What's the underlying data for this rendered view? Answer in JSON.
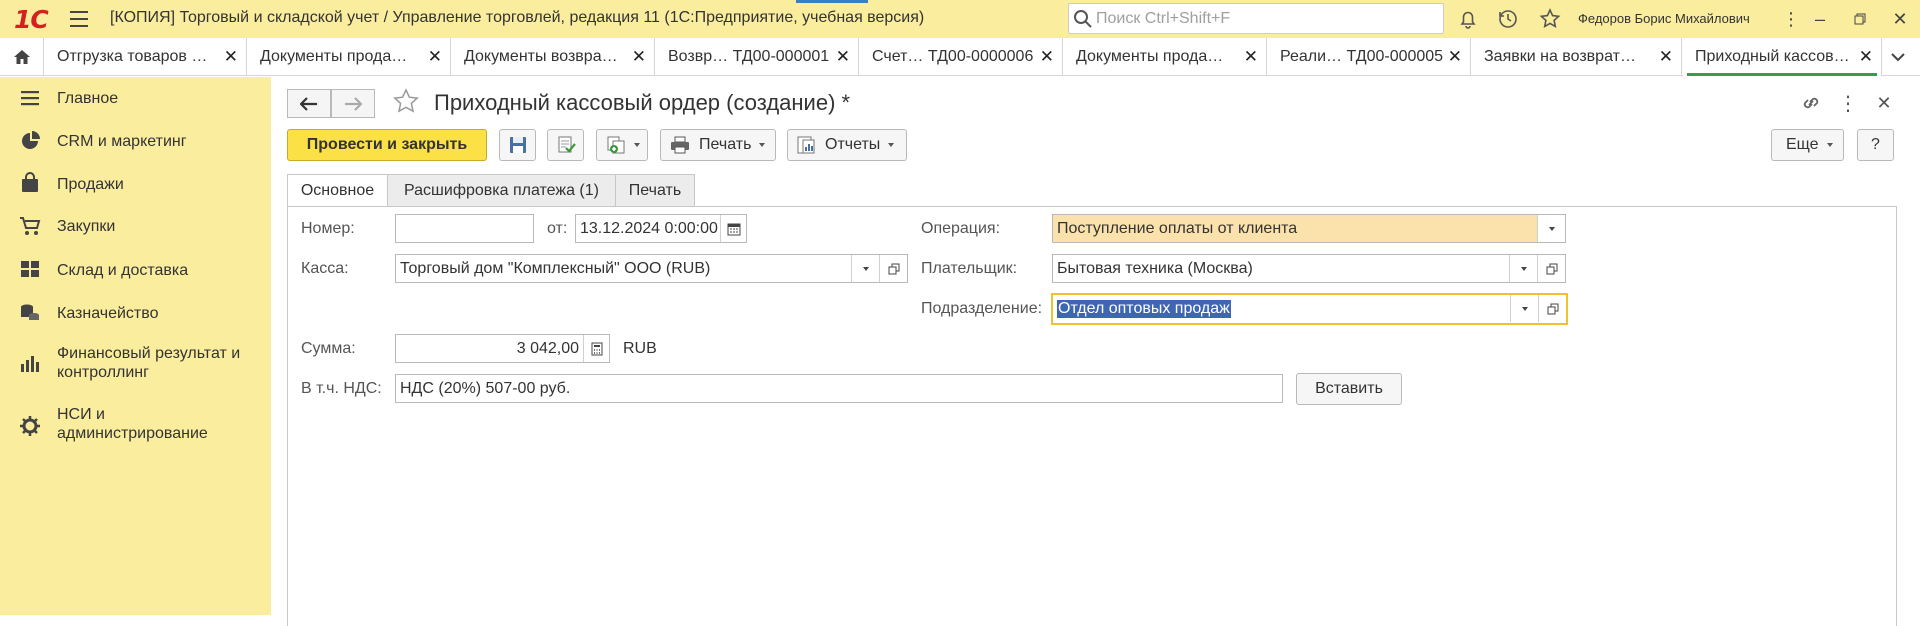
{
  "app": {
    "logo": "1С",
    "title": "[КОПИЯ] Торговый и складской учет / Управление торговлей, редакция 11  (1С:Предприятие, учебная версия)",
    "search_placeholder": "Поиск Ctrl+Shift+F",
    "user": "Федоров Борис Михайлович",
    "accent_color": "#fbed9e"
  },
  "tabs": [
    {
      "label": "Отгрузка товаров …"
    },
    {
      "label": "Документы прода…"
    },
    {
      "label": "Документы возвра…"
    },
    {
      "label": "Возвр… ТД00-000001"
    },
    {
      "label": "Счет… ТД00-0000006"
    },
    {
      "label": "Документы прода…"
    },
    {
      "label": "Реали… ТД00-000005"
    },
    {
      "label": "Заявки на возврат…"
    },
    {
      "label": "Приходный кассов…"
    }
  ],
  "sidebar": {
    "items": [
      {
        "label": "Главное",
        "icon": "list-icon"
      },
      {
        "label": "CRM и маркетинг",
        "icon": "pie-chart-icon"
      },
      {
        "label": "Продажи",
        "icon": "shopping-bag-icon"
      },
      {
        "label": "Закупки",
        "icon": "cart-icon"
      },
      {
        "label": "Склад и доставка",
        "icon": "warehouse-icon"
      },
      {
        "label": "Казначейство",
        "icon": "coins-icon"
      },
      {
        "label": "Финансовый результат и",
        "label2": "контроллинг",
        "icon": "bar-chart-icon"
      },
      {
        "label": "НСИ и",
        "label2": "администрирование",
        "icon": "gear-icon"
      }
    ]
  },
  "form": {
    "title": "Приходный кассовый ордер (создание) *",
    "toolbar": {
      "post_close": "Провести и закрыть",
      "print": "Печать",
      "reports": "Отчеты",
      "more": "Еще",
      "help": "?"
    },
    "tabs": [
      "Основное",
      "Расшифровка платежа (1)",
      "Печать"
    ],
    "fields": {
      "number_label": "Номер:",
      "number_value": "",
      "date_label": "от:",
      "date_value": "13.12.2024  0:00:00",
      "operation_label": "Операция:",
      "operation_value": "Поступление оплаты от клиента",
      "cash_label": "Касса:",
      "cash_value": "Торговый дом \"Комплексный\" ООО (RUB)",
      "payer_label": "Плательщик:",
      "payer_value": "Бытовая техника (Москва)",
      "division_label": "Подразделение:",
      "division_value": "Отдел оптовых продаж",
      "amount_label": "Сумма:",
      "amount_value": "3 042,00",
      "currency": "RUB",
      "vat_label": "В т.ч. НДС:",
      "vat_value": "НДС (20%) 507-00 руб.",
      "insert_button": "Вставить"
    }
  }
}
